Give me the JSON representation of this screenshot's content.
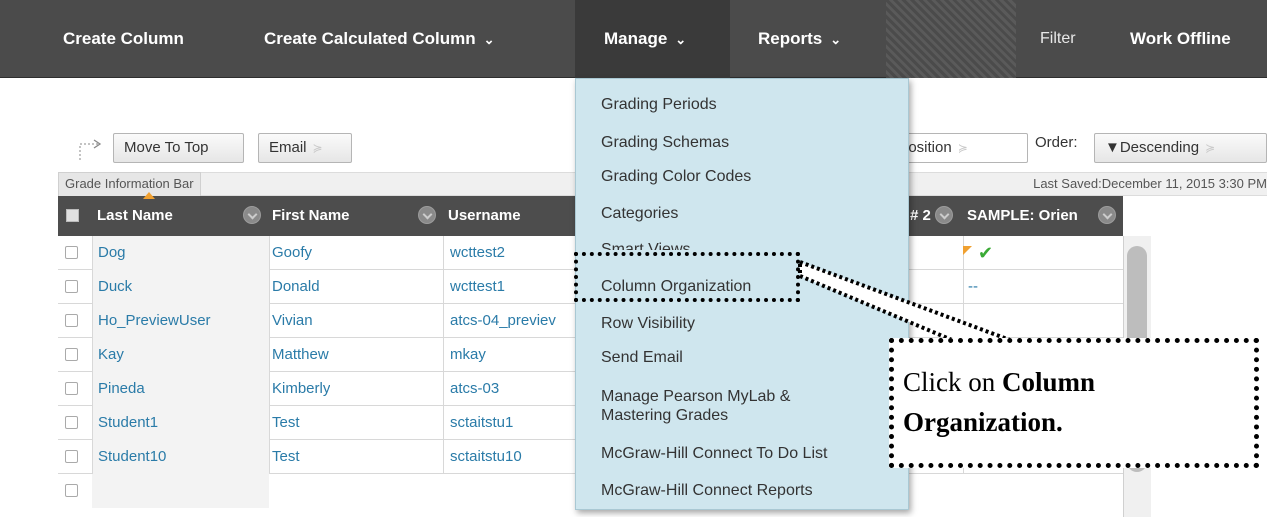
{
  "toolbar": {
    "create_column": "Create Column",
    "create_calculated_column": "Create Calculated Column",
    "manage": "Manage",
    "reports": "Reports",
    "filter": "Filter",
    "work_offline": "Work Offline",
    "chevron_glyph": "⌄"
  },
  "actions": {
    "move_to_top": "Move To Top",
    "email": "Email",
    "sort_by": "t Position",
    "order_label": "Order:",
    "order_value": "▼Descending",
    "dropdown_glyph": "≽"
  },
  "info_bar": {
    "tab": "Grade Information Bar",
    "last_saved": "Last Saved:December 11, 2015 3:30 PM"
  },
  "grid": {
    "headers": {
      "last_name": "Last Name",
      "first_name": "First Name",
      "username": "Username",
      "hidden_col": "# 2",
      "sample": "SAMPLE: Orien"
    },
    "rows": [
      {
        "last": "Dog",
        "first": "Goofy",
        "user": "wcttest2",
        "grade": "✔"
      },
      {
        "last": "Duck",
        "first": "Donald",
        "user": "wcttest1",
        "grade": "--"
      },
      {
        "last": "Ho_PreviewUser",
        "first": "Vivian",
        "user": "atcs-04_previev",
        "grade": ""
      },
      {
        "last": "Kay",
        "first": "Matthew",
        "user": "mkay",
        "grade": ""
      },
      {
        "last": "Pineda",
        "first": "Kimberly",
        "user": "atcs-03",
        "grade": ""
      },
      {
        "last": "Student1",
        "first": "Test",
        "user": "sctaitstu1",
        "grade": ""
      },
      {
        "last": "Student10",
        "first": "Test",
        "user": "sctaitstu10",
        "grade": "--"
      }
    ]
  },
  "manage_menu": {
    "items": [
      "Grading Periods",
      "Grading Schemas",
      "Grading Color Codes",
      "Categories",
      "Smart Views",
      "Column Organization",
      "Row Visibility",
      "Send Email",
      "Manage Pearson MyLab &",
      "Mastering Grades",
      "McGraw-Hill Connect To Do List",
      "McGraw-Hill Connect Reports"
    ]
  },
  "callout": {
    "prefix": "Click on ",
    "bold": "Column Organization."
  },
  "colors": {
    "toolbar_bg": "#4b4b4b",
    "menu_bg": "#cfe6ee",
    "link": "#2a7ba8",
    "sort_caret": "#f0a030",
    "check_green": "#3aaa35"
  }
}
